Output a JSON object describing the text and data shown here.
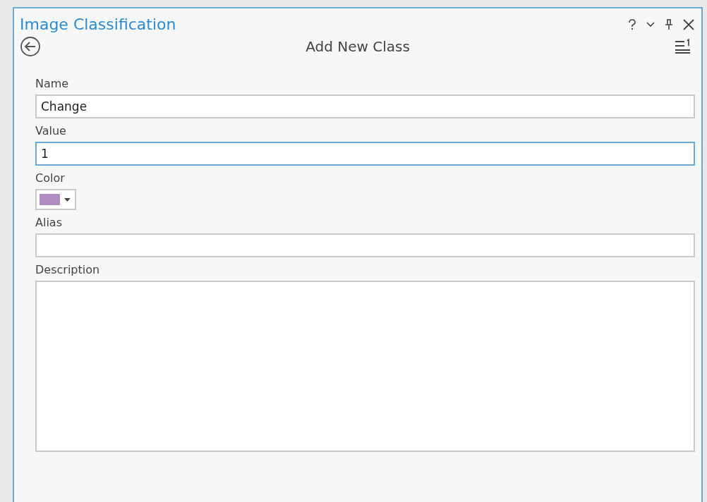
{
  "pane": {
    "title": "Image Classification"
  },
  "header": {
    "title": "Add New Class"
  },
  "fields": [
    {
      "kind": "text",
      "label": "Name",
      "value": "Change",
      "focused": false
    },
    {
      "kind": "text",
      "label": "Value",
      "value": "1",
      "focused": true
    },
    {
      "kind": "color",
      "label": "Color",
      "color": "#b08cc0"
    },
    {
      "kind": "text",
      "label": "Alias",
      "focused": false
    },
    {
      "kind": "textarea",
      "label": "Description",
      "focused": false
    }
  ]
}
